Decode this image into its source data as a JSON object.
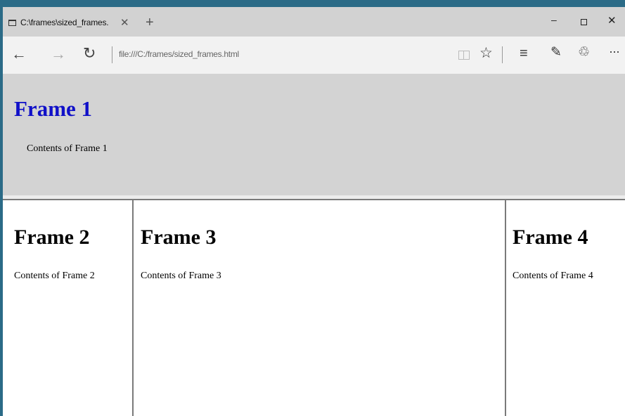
{
  "browser": {
    "tab": {
      "title": "C:\\frames\\sized_frames.",
      "close_glyph": "✕",
      "icon": "page-icon"
    },
    "new_tab_glyph": "+",
    "window_controls": {
      "minimize": "–",
      "close": "✕"
    },
    "nav": {
      "back_glyph": "←",
      "forward_glyph": "→",
      "refresh_glyph": "↻",
      "address": "file:///C:/frames/sized_frames.html",
      "favorite_glyph": "☆",
      "hub_glyph": "≡",
      "note_glyph": "✎",
      "share_glyph": "♲",
      "more_glyph": "···"
    }
  },
  "frames": {
    "frame1": {
      "title": "Frame 1",
      "text": "Contents of Frame 1",
      "background": "#d3d3d3",
      "title_color": "#1010c8"
    },
    "frame2": {
      "title": "Frame 2",
      "text": "Contents of Frame 2"
    },
    "frame3": {
      "title": "Frame 3",
      "text": "Contents of Frame 3"
    },
    "frame4": {
      "title": "Frame 4",
      "text": "Contents of Frame 4"
    }
  },
  "colors": {
    "window_border": "#2b6b87",
    "tabstrip": "#d2d2d2",
    "navbar": "#f2f2f2"
  }
}
